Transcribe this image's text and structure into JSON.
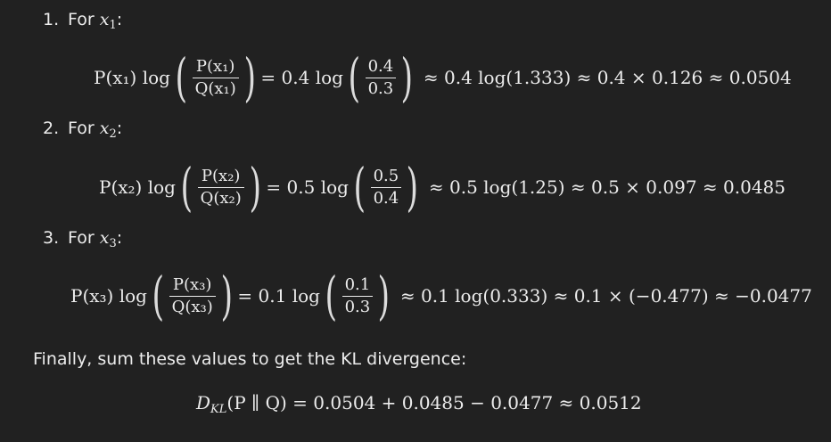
{
  "items": [
    {
      "number": "1.",
      "label_prefix": "For ",
      "var": "x",
      "sub": "1",
      "label_suffix": ":",
      "lhs": "P(x₁) log",
      "num": "P(x₁)",
      "den": "Q(x₁)",
      "coef": "= 0.4 log",
      "ratio_num": "0.4",
      "ratio_den": "0.3",
      "rhs": "≈ 0.4 log(1.333) ≈ 0.4 × 0.126 ≈ 0.0504"
    },
    {
      "number": "2.",
      "label_prefix": "For ",
      "var": "x",
      "sub": "2",
      "label_suffix": ":",
      "lhs": "P(x₂) log",
      "num": "P(x₂)",
      "den": "Q(x₂)",
      "coef": "= 0.5 log",
      "ratio_num": "0.5",
      "ratio_den": "0.4",
      "rhs": "≈ 0.5 log(1.25) ≈ 0.5 × 0.097 ≈ 0.0485"
    },
    {
      "number": "3.",
      "label_prefix": "For ",
      "var": "x",
      "sub": "3",
      "label_suffix": ":",
      "lhs": "P(x₃) log",
      "num": "P(x₃)",
      "den": "Q(x₃)",
      "coef": "= 0.1 log",
      "ratio_num": "0.1",
      "ratio_den": "0.3",
      "rhs": "≈ 0.1 log(0.333) ≈ 0.1 × (−0.477) ≈ −0.0477"
    }
  ],
  "summary_text": "Finally, sum these values to get the KL divergence:",
  "final_equation": "D_KL(P ∥ Q) = 0.0504 + 0.0485 − 0.0477 ≈ 0.0512",
  "final_lhs_D": "D",
  "final_lhs_sub": "KL",
  "final_rest": "(P ∥ Q) = 0.0504 + 0.0485 − 0.0477 ≈ 0.0512"
}
